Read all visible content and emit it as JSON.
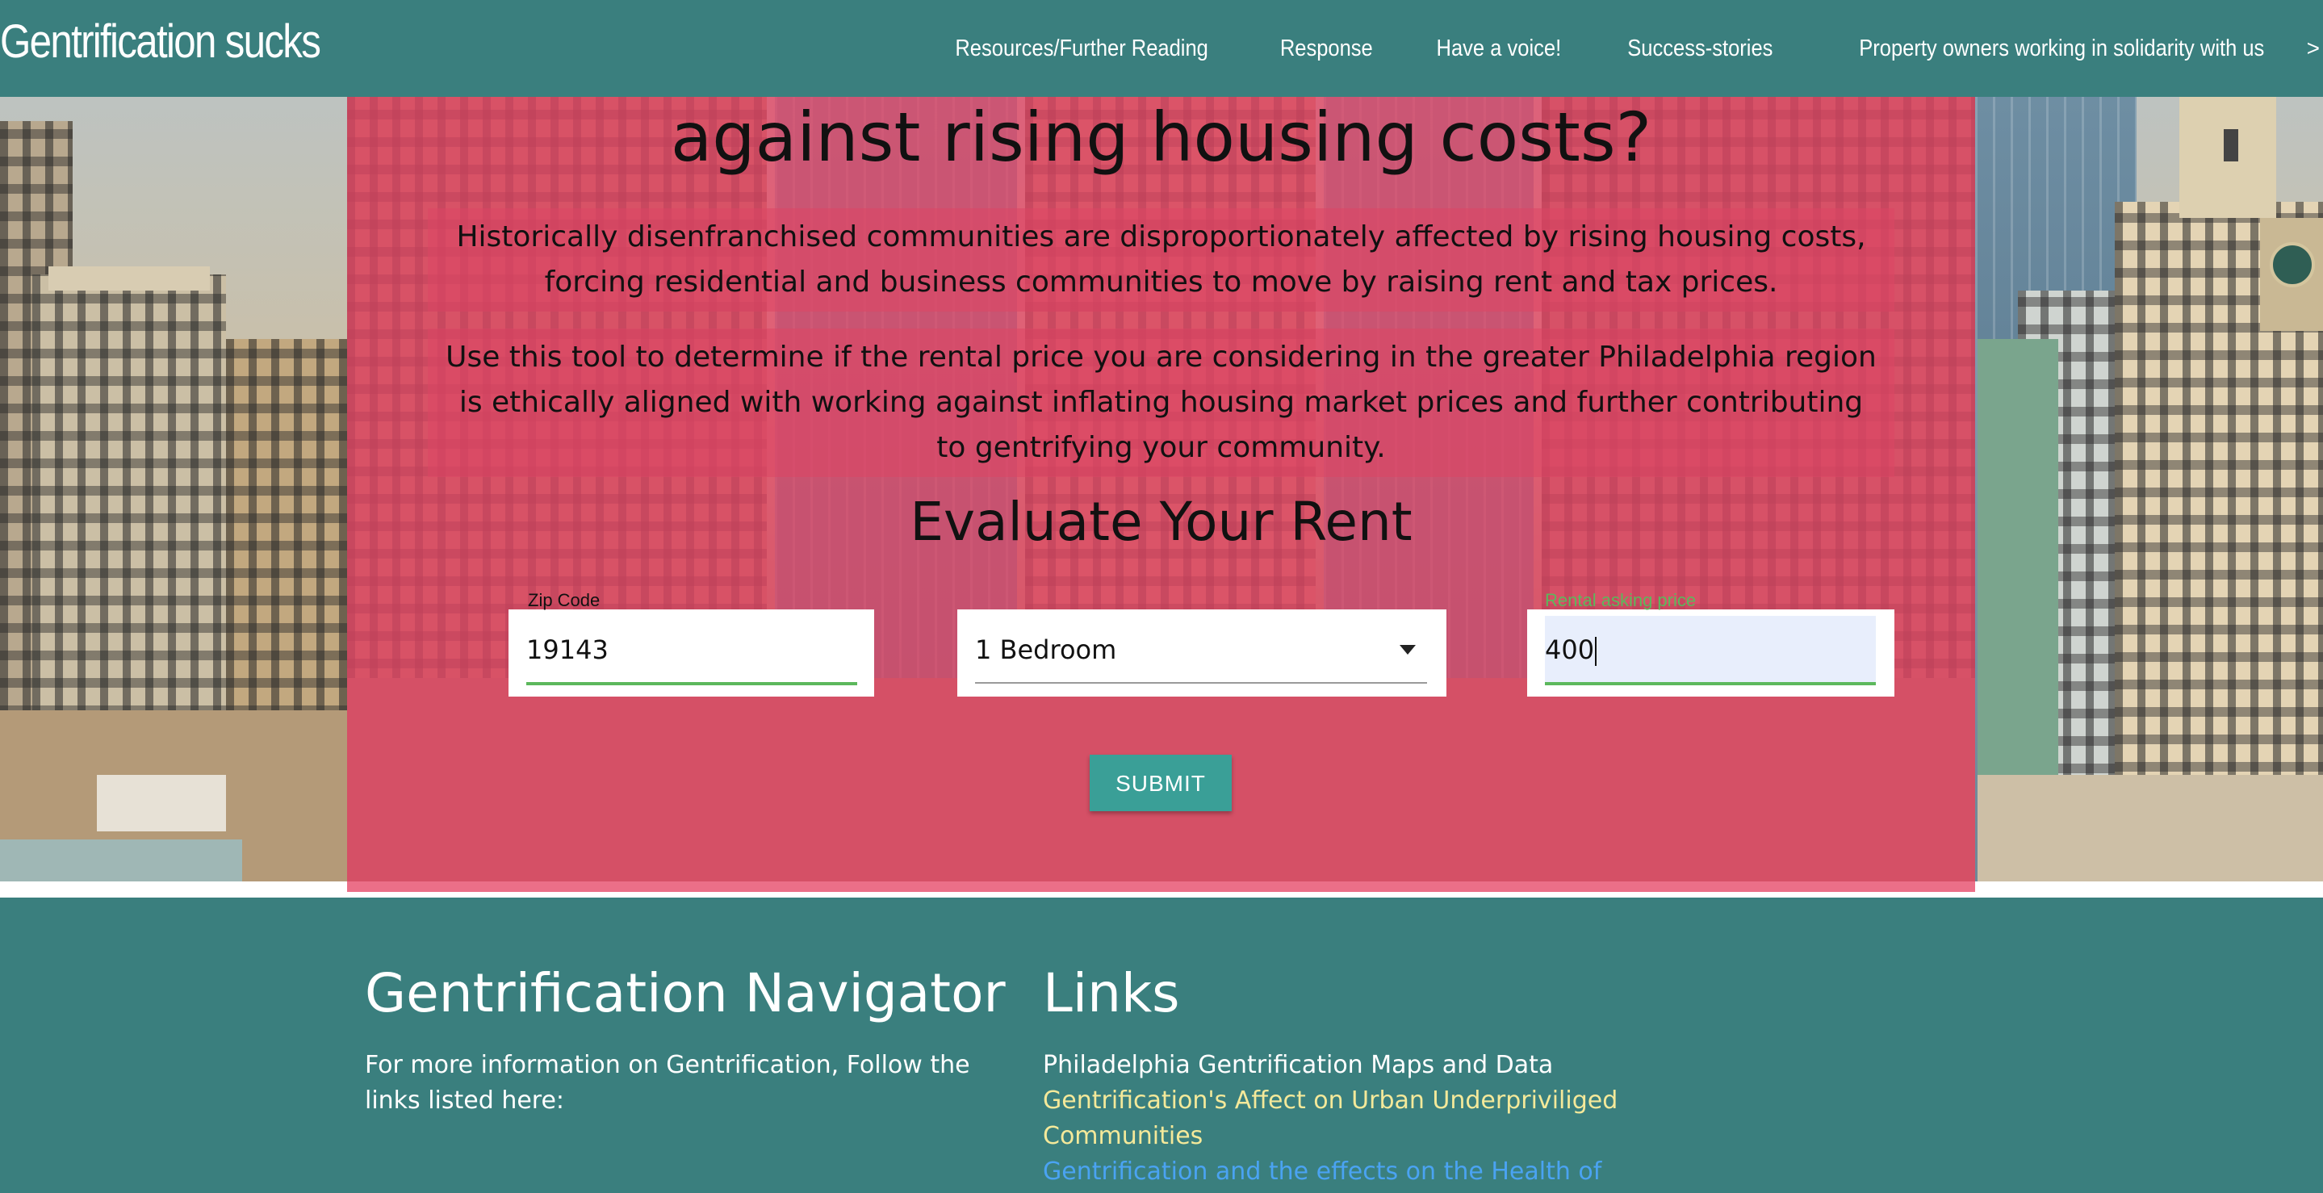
{
  "nav": {
    "brand": "Gentrification sucks",
    "links": [
      "Resources/Further Reading",
      "Response",
      "Have a voice!",
      "Success-stories",
      "Property owners working in solidarity with us"
    ],
    "more": ">"
  },
  "hero": {
    "headline": "against rising housing costs?",
    "paragraph1": "Historically disenfranchised communities are disproportionately affected by rising housing costs, forcing residential and business communities to move by raising rent and tax prices.",
    "paragraph2": "Use this tool to determine if the rental price you are considering in the greater Philadelphia region is ethically aligned with working against inflating housing market prices and further contributing to gentrifying your community."
  },
  "form": {
    "title": "Evaluate Your Rent",
    "zip_label": "Zip Code",
    "zip_value": "19143",
    "bedroom_value": "1 Bedroom",
    "price_label": "Rental asking price",
    "price_value": "400",
    "submit_label": "SUBMIT"
  },
  "footer": {
    "navigator_title": "Gentrification Navigator",
    "navigator_text": "For more information on Gentrification, Follow the links listed here:",
    "links_title": "Links",
    "links": [
      "Philadelphia Gentrification Maps and Data",
      "Gentrification's Affect on Urban Underpriviliged Communities",
      "Gentrification and the effects on the Health of"
    ]
  },
  "colors": {
    "nav_bg": "#3a7f7e",
    "panel_overlay": "#e64666",
    "submit_bg": "#3a9f97",
    "active_underline": "#5cb85c",
    "link_yellow": "#f4e99a",
    "link_blue": "#4aa3f2"
  }
}
